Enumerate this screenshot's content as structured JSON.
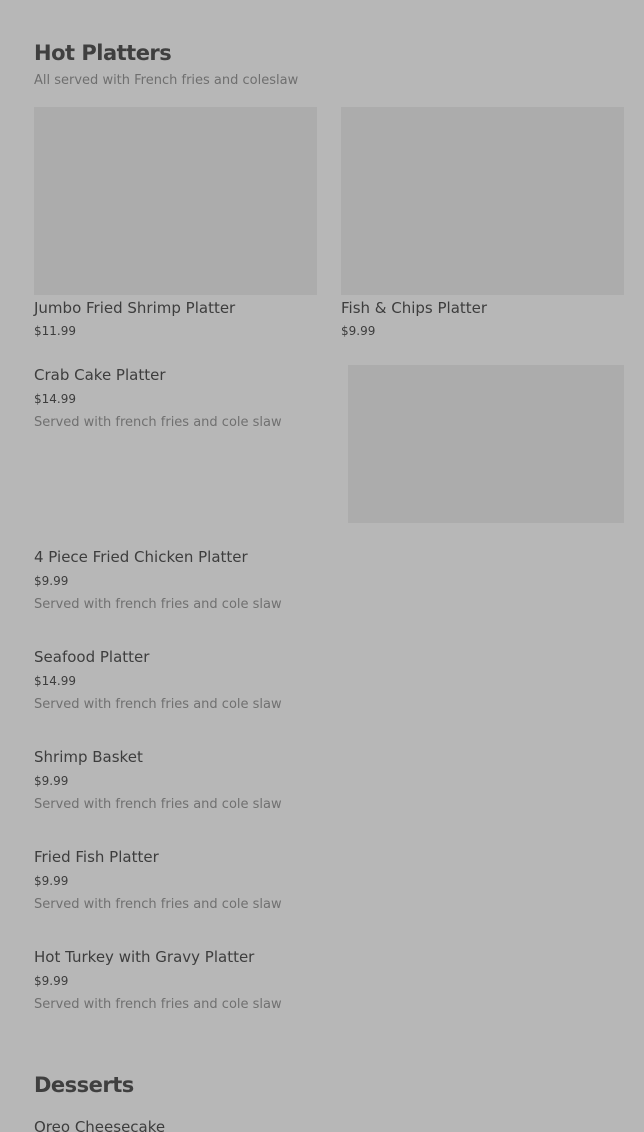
{
  "hot_platters": {
    "title": "Hot Platters",
    "subtitle": "All served with French fries and coleslaw",
    "featured": [
      {
        "name": "Jumbo Fried Shrimp Platter",
        "price": "$11.99"
      },
      {
        "name": "Fish & Chips Platter",
        "price": "$9.99"
      }
    ],
    "items": [
      {
        "name": "Crab Cake Platter",
        "price": "$14.99",
        "desc": "Served with french fries and cole slaw"
      },
      {
        "name": "4 Piece Fried Chicken Platter",
        "price": "$9.99",
        "desc": "Served with french fries and cole slaw"
      },
      {
        "name": "Seafood Platter",
        "price": "$14.99",
        "desc": "Served with french fries and cole slaw"
      },
      {
        "name": "Shrimp Basket",
        "price": "$9.99",
        "desc": "Served with french fries and cole slaw"
      },
      {
        "name": "Fried Fish Platter",
        "price": "$9.99",
        "desc": "Served with french fries and cole slaw"
      },
      {
        "name": "Hot Turkey with Gravy Platter",
        "price": "$9.99",
        "desc": "Served with french fries and cole slaw"
      }
    ]
  },
  "desserts": {
    "title": "Desserts",
    "items": [
      {
        "name": "Oreo Cheesecake"
      }
    ]
  }
}
